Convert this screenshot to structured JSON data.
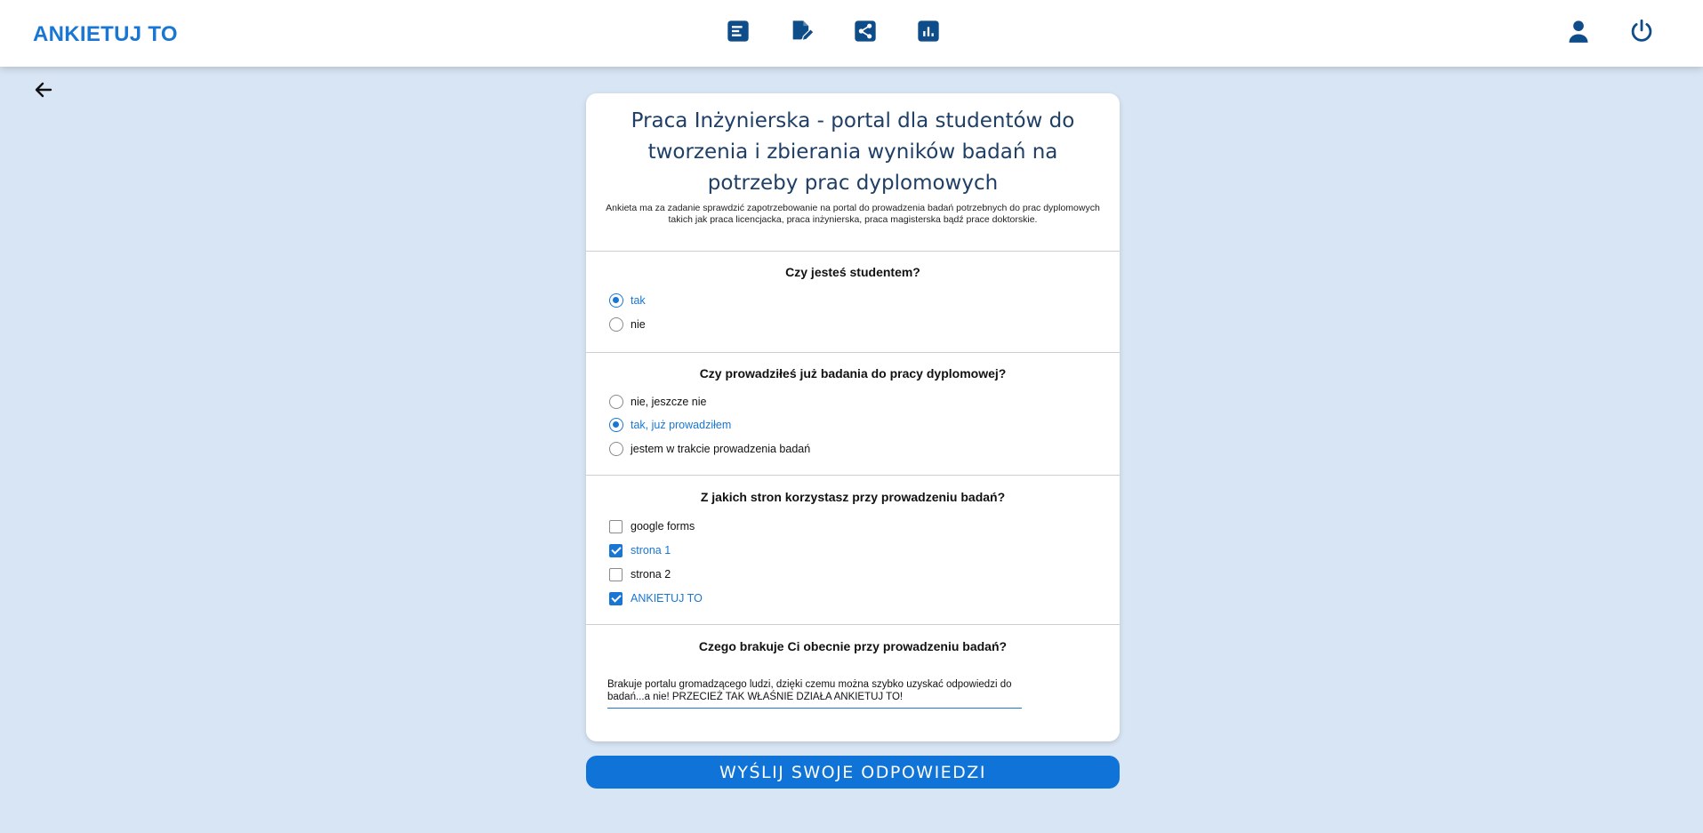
{
  "app": {
    "brand": "ANKIETUJ TO",
    "accent_color": "#1976d2",
    "nav_icon_color": "#0f4c8a"
  },
  "topbar": {
    "icons": [
      "list-icon",
      "edit-document-icon",
      "share-icon",
      "bar-chart-icon",
      "user-icon",
      "power-icon"
    ]
  },
  "survey": {
    "title": "Praca Inżynierska - portal dla studentów do tworzenia i zbierania wyników badań na potrzeby prac dyplomowych",
    "description": "Ankieta ma za zadanie sprawdzić zapotrzebowanie na portal do prowadzenia badań potrzebnych do prac dyplomowych takich jak praca licencjacka, praca inżynierska, praca magisterska bądź prace doktorskie.",
    "questions": [
      {
        "type": "radio",
        "title": "Czy jesteś studentem?",
        "options": [
          {
            "label": "tak",
            "selected": true
          },
          {
            "label": "nie",
            "selected": false
          }
        ]
      },
      {
        "type": "radio",
        "title": "Czy prowadziłeś już badania do pracy dyplomowej?",
        "options": [
          {
            "label": "nie, jeszcze nie",
            "selected": false
          },
          {
            "label": "tak, już prowadziłem",
            "selected": true
          },
          {
            "label": "jestem w trakcie prowadzenia badań",
            "selected": false
          }
        ]
      },
      {
        "type": "checkbox",
        "title": "Z jakich stron korzystasz przy prowadzeniu badań?",
        "options": [
          {
            "label": "google forms",
            "selected": false
          },
          {
            "label": "strona 1",
            "selected": true
          },
          {
            "label": "strona 2",
            "selected": false
          },
          {
            "label": "ANKIETUJ TO",
            "selected": true
          }
        ]
      },
      {
        "type": "text",
        "title": "Czego brakuje Ci obecnie przy prowadzeniu badań?",
        "answer": "Brakuje portalu gromadzącego ludzi, dzięki czemu można szybko uzyskać odpowiedzi do badań...a nie! PRZECIEŻ TAK WŁAŚNIE DZIAŁA ANKIETUJ TO!"
      }
    ]
  },
  "submit_label": "WYŚLIJ SWOJE ODPOWIEDZI"
}
